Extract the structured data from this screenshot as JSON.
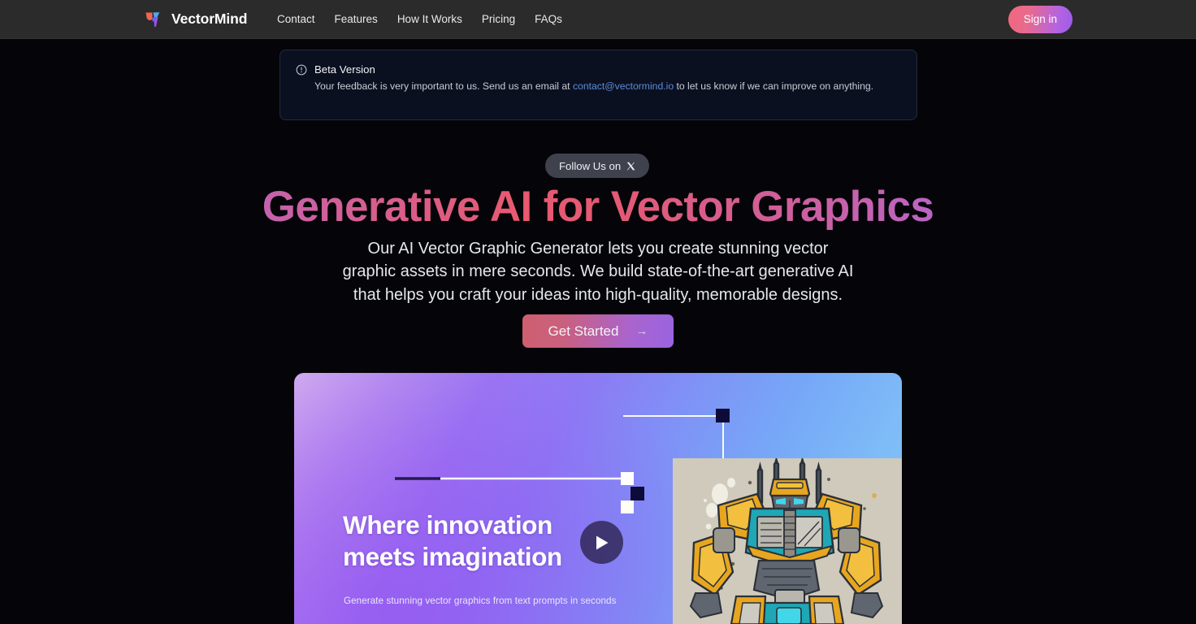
{
  "navbar": {
    "brand": "VectorMind",
    "logo_icon": "vectormind-logo-icon",
    "links": [
      {
        "label": "Contact"
      },
      {
        "label": "Features"
      },
      {
        "label": "How It Works"
      },
      {
        "label": "Pricing"
      },
      {
        "label": "FAQs"
      }
    ],
    "signin_label": "Sign in"
  },
  "beta_banner": {
    "icon": "info-circle-icon",
    "title": "Beta Version",
    "text_before": "Your feedback is very important to us. Send us an email at ",
    "email": "contact@vectormind.io",
    "text_after": " to let us know if we can improve on anything.",
    "bg_color": "#0b1020",
    "link_color": "#5b8dd9"
  },
  "hero": {
    "follow_pill_label": "Follow Us on",
    "follow_pill_icon": "x-logo-icon",
    "headline": "Generative AI for Vector Graphics",
    "subhead_line1": "Our AI Vector Graphic Generator lets you create stunning vector",
    "subhead_line2": "graphic assets in mere seconds. We build state-of-the-art generative AI",
    "subhead_line3": "that helps you craft your ideas into high-quality, memorable designs.",
    "cta_label": "Get Started",
    "cta_arrow": "→",
    "gradient_start": "#9b6ae0",
    "gradient_mid": "#e8596f",
    "gradient_end": "#a869e6"
  },
  "hero_card": {
    "headline_line1": "Where innovation",
    "headline_line2": "meets imagination",
    "caption": "Generate stunning vector graphics from text prompts in seconds",
    "play_button_icon": "play-icon",
    "artwork_alt": "mecha-robot-illustration",
    "bg_gradient_start": "#cfa9ef",
    "bg_gradient_end": "#86c4f8"
  }
}
